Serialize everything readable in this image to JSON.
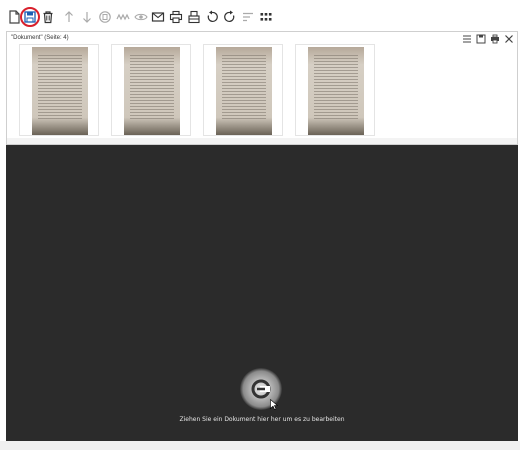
{
  "toolbar": {
    "icons": [
      "new-document-icon",
      "save-icon",
      "delete-icon",
      "move-up-icon",
      "move-down-icon",
      "ocr-icon",
      "signature-icon",
      "view-icon",
      "email-icon",
      "print-icon",
      "scan-icon",
      "rotate-left-icon",
      "rotate-right-icon",
      "sort-icon",
      "grid-view-icon"
    ],
    "highlight_color": "#d8202c"
  },
  "document_panel": {
    "title": "\"Dokument\" (Seite: 4)",
    "page_count": 4
  },
  "dropzone": {
    "text": "Ziehen Sie ein Dokument hier her um es zu bearbeiten"
  }
}
